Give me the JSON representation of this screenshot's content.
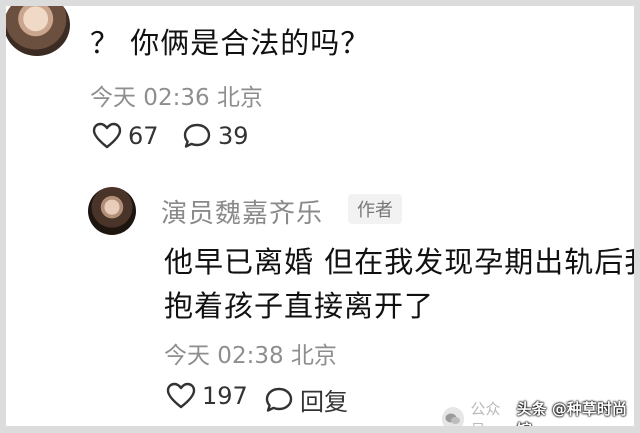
{
  "question": {
    "text": "？ 你俩是合法的吗？",
    "time": "今天 02:36 北京",
    "likes": "67",
    "comments": "39"
  },
  "reply": {
    "author": "演员魏嘉齐乐",
    "badge": "作者",
    "line1": "他早已离婚 但在我发现孕期出轨后我",
    "line2": "抱着孩子直接离开了",
    "time": "今天 02:38 北京",
    "likes": "197",
    "reply_label": "回复"
  },
  "watermark": {
    "faint": "公众号",
    "strong": "头条 @种草时尚馆"
  }
}
